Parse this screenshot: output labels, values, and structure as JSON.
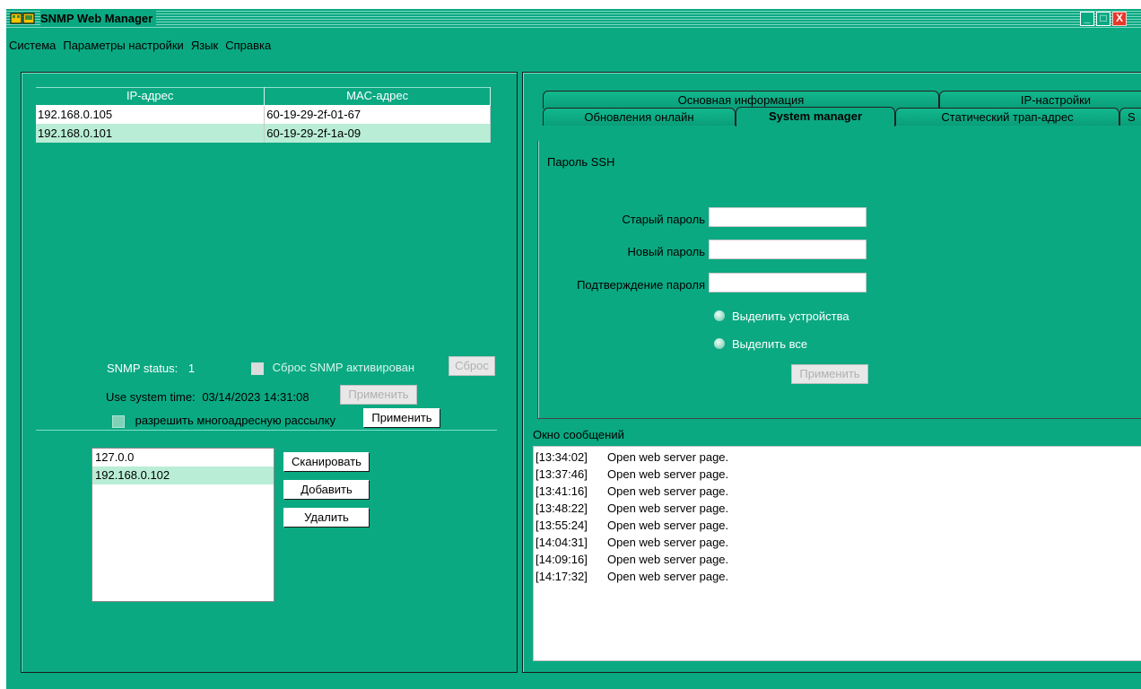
{
  "window": {
    "title": "SNMP Web Manager",
    "icon": "network-device-icon",
    "controls": {
      "minimize": "_",
      "maximize": "□",
      "close": "X"
    }
  },
  "menu": [
    "Система",
    "Параметры настройки",
    "Язык",
    "Справка"
  ],
  "device_table": {
    "headers": [
      "IP-адрес",
      "MAC-адрес"
    ],
    "rows": [
      {
        "ip": "192.168.0.105",
        "mac": "60-19-29-2f-01-67",
        "selected": false
      },
      {
        "ip": "192.168.0.101",
        "mac": "60-19-29-2f-1a-09",
        "selected": true
      }
    ]
  },
  "status": {
    "snmp_status_label": "SNMP status:",
    "snmp_status_value": "1",
    "snmp_reset_label": "Сброс SNMP активирован",
    "reset_button": "Сброс",
    "system_time_label": "Use system time:",
    "system_time_value": "03/14/2023 14:31:08",
    "apply_time_button": "Применить",
    "multicast_label": "разрешить многоадресную рассылку",
    "apply_multicast_button": "Применить"
  },
  "ip_list": {
    "items": [
      "127.0.0",
      "192.168.0.102"
    ],
    "selected_index": 1,
    "scan_button": "Сканировать",
    "add_button": "Добавить",
    "delete_button": "Удалить"
  },
  "tabs": {
    "row1": [
      "Основная информация",
      "IP-настройки"
    ],
    "row2": [
      "Обновления онлайн",
      "System manager",
      "Статический трап-адрес",
      "S"
    ],
    "active": "System manager"
  },
  "ssh_form": {
    "section_title": "Пароль SSH",
    "old_password_label": "Старый пароль",
    "new_password_label": "Новый пароль",
    "confirm_password_label": "Подтверждение пароля",
    "old_password_value": "",
    "new_password_value": "",
    "confirm_password_value": "",
    "radio_selected_devices": "Выделить устройства",
    "radio_select_all": "Выделить все",
    "apply_button": "Применить"
  },
  "messages": {
    "title": "Окно сообщений",
    "lines": [
      {
        "time": "[13:34:02]",
        "text": "Open web server page."
      },
      {
        "time": "[13:37:46]",
        "text": "Open web server page."
      },
      {
        "time": "[13:41:16]",
        "text": "Open web server page."
      },
      {
        "time": "[13:48:22]",
        "text": "Open web server page."
      },
      {
        "time": "[13:55:24]",
        "text": "Open web server page."
      },
      {
        "time": "[14:04:31]",
        "text": "Open web server page."
      },
      {
        "time": "[14:09:16]",
        "text": "Open web server page."
      },
      {
        "time": "[14:17:32]",
        "text": "Open web server page."
      }
    ]
  },
  "colors": {
    "window_bg": "#0aa982",
    "selection": "#b9edd6",
    "close_button": "#e8362b"
  }
}
